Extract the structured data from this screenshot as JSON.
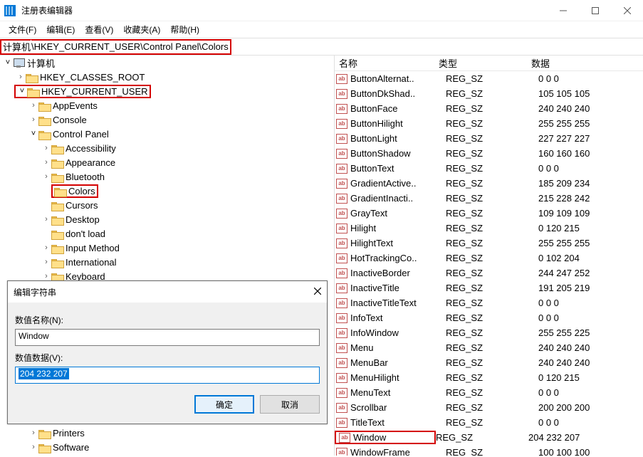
{
  "window": {
    "title": "注册表编辑器"
  },
  "menu": {
    "file": "文件(F)",
    "edit": "编辑(E)",
    "view": "查看(V)",
    "fav": "收藏夹(A)",
    "help": "帮助(H)"
  },
  "addressbar": {
    "prefix": "计算机",
    "path": "\\HKEY_CURRENT_USER\\Control Panel\\Colors"
  },
  "tree": {
    "root": "计算机",
    "hkcr": "HKEY_CLASSES_ROOT",
    "hkcu": "HKEY_CURRENT_USER",
    "items": {
      "appevents": "AppEvents",
      "console": "Console",
      "controlpanel": "Control Panel",
      "accessibility": "Accessibility",
      "appearance": "Appearance",
      "bluetooth": "Bluetooth",
      "colors": "Colors",
      "cursors": "Cursors",
      "desktop": "Desktop",
      "dontload": "don't load",
      "inputmethod": "Input Method",
      "international": "International",
      "keyboard": "Keyboard",
      "printers": "Printers",
      "software": "Software"
    }
  },
  "list_headers": {
    "name": "名称",
    "type": "类型",
    "data": "数据"
  },
  "values": [
    {
      "name": "ButtonAlternat..",
      "type": "REG_SZ",
      "data": "0 0 0"
    },
    {
      "name": "ButtonDkShad..",
      "type": "REG_SZ",
      "data": "105 105 105"
    },
    {
      "name": "ButtonFace",
      "type": "REG_SZ",
      "data": "240 240 240"
    },
    {
      "name": "ButtonHilight",
      "type": "REG_SZ",
      "data": "255 255 255"
    },
    {
      "name": "ButtonLight",
      "type": "REG_SZ",
      "data": "227 227 227"
    },
    {
      "name": "ButtonShadow",
      "type": "REG_SZ",
      "data": "160 160 160"
    },
    {
      "name": "ButtonText",
      "type": "REG_SZ",
      "data": "0 0 0"
    },
    {
      "name": "GradientActive..",
      "type": "REG_SZ",
      "data": "185 209 234"
    },
    {
      "name": "GradientInacti..",
      "type": "REG_SZ",
      "data": "215 228 242"
    },
    {
      "name": "GrayText",
      "type": "REG_SZ",
      "data": "109 109 109"
    },
    {
      "name": "Hilight",
      "type": "REG_SZ",
      "data": "0 120 215"
    },
    {
      "name": "HilightText",
      "type": "REG_SZ",
      "data": "255 255 255"
    },
    {
      "name": "HotTrackingCo..",
      "type": "REG_SZ",
      "data": "0 102 204"
    },
    {
      "name": "InactiveBorder",
      "type": "REG_SZ",
      "data": "244 247 252"
    },
    {
      "name": "InactiveTitle",
      "type": "REG_SZ",
      "data": "191 205 219"
    },
    {
      "name": "InactiveTitleText",
      "type": "REG_SZ",
      "data": "0 0 0"
    },
    {
      "name": "InfoText",
      "type": "REG_SZ",
      "data": "0 0 0"
    },
    {
      "name": "InfoWindow",
      "type": "REG_SZ",
      "data": "255 255 225"
    },
    {
      "name": "Menu",
      "type": "REG_SZ",
      "data": "240 240 240"
    },
    {
      "name": "MenuBar",
      "type": "REG_SZ",
      "data": "240 240 240"
    },
    {
      "name": "MenuHilight",
      "type": "REG_SZ",
      "data": "0 120 215"
    },
    {
      "name": "MenuText",
      "type": "REG_SZ",
      "data": "0 0 0"
    },
    {
      "name": "Scrollbar",
      "type": "REG_SZ",
      "data": "200 200 200"
    },
    {
      "name": "TitleText",
      "type": "REG_SZ",
      "data": "0 0 0"
    },
    {
      "name": "Window",
      "type": "REG_SZ",
      "data": "204 232 207",
      "highlight": true
    },
    {
      "name": "WindowFrame",
      "type": "REG_SZ",
      "data": "100 100 100"
    }
  ],
  "dialog": {
    "title": "编辑字符串",
    "name_label": "数值名称(N):",
    "name_value": "Window",
    "data_label": "数值数据(V):",
    "data_value": "204 232 207",
    "ok": "确定",
    "cancel": "取消"
  }
}
